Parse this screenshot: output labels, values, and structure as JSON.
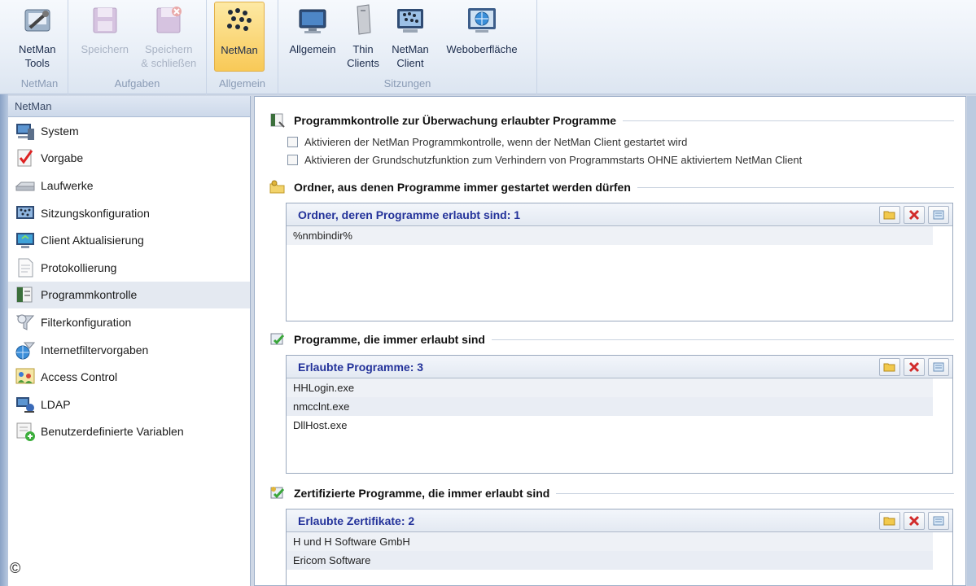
{
  "ribbon": {
    "groups": [
      {
        "label": "NetMan",
        "buttons": [
          {
            "label1": "NetMan",
            "label2": "Tools",
            "icon": "tools-icon"
          }
        ]
      },
      {
        "label": "Aufgaben",
        "buttons": [
          {
            "label1": "Speichern",
            "label2": "",
            "icon": "floppy-icon"
          },
          {
            "label1": "Speichern",
            "label2": "& schließen",
            "icon": "floppy-close-icon"
          }
        ]
      },
      {
        "label": "Allgemein",
        "buttons": [
          {
            "label1": "NetMan",
            "label2": "",
            "icon": "netman-dots-icon"
          }
        ]
      },
      {
        "label": "Sitzungen",
        "buttons": [
          {
            "label1": "Allgemein",
            "label2": "",
            "icon": "monitor-icon"
          },
          {
            "label1": "Thin",
            "label2": "Clients",
            "icon": "thin-client-icon"
          },
          {
            "label1": "NetMan",
            "label2": "Client",
            "icon": "netman-client-icon"
          },
          {
            "label1": "Weboberfläche",
            "label2": "",
            "icon": "web-icon"
          }
        ]
      }
    ]
  },
  "nav": {
    "header": "NetMan",
    "items": [
      {
        "label": "System",
        "icon": "computer-icon"
      },
      {
        "label": "Vorgabe",
        "icon": "checklist-icon"
      },
      {
        "label": "Laufwerke",
        "icon": "drive-icon"
      },
      {
        "label": "Sitzungskonfiguration",
        "icon": "session-icon"
      },
      {
        "label": "Client Aktualisierung",
        "icon": "client-update-icon"
      },
      {
        "label": "Protokollierung",
        "icon": "document-icon"
      },
      {
        "label": "Programmkontrolle",
        "icon": "program-control-icon"
      },
      {
        "label": "Filterkonfiguration",
        "icon": "filter-icon"
      },
      {
        "label": "Internetfiltervorgaben",
        "icon": "internet-filter-icon"
      },
      {
        "label": "Access Control",
        "icon": "access-control-icon"
      },
      {
        "label": "LDAP",
        "icon": "ldap-icon"
      },
      {
        "label": "Benutzerdefinierte Variablen",
        "icon": "variables-icon"
      }
    ],
    "selected_index": 6
  },
  "content": {
    "section1": {
      "title": "Programmkontrolle zur Überwachung erlaubter Programme",
      "checkboxes": [
        "Aktivieren der NetMan Programmkontrolle, wenn der NetMan Client gestartet wird",
        "Aktivieren der Grundschutzfunktion zum Verhindern von Programmstarts OHNE aktiviertem NetMan Client"
      ]
    },
    "section2": {
      "title": "Ordner, aus denen Programme immer gestartet werden dürfen",
      "list_title": "Ordner, deren Programme erlaubt sind: 1",
      "rows": [
        "%nmbindir%"
      ]
    },
    "section3": {
      "title": "Programme, die immer erlaubt sind",
      "list_title": "Erlaubte Programme: 3",
      "rows": [
        "HHLogin.exe",
        "nmcclnt.exe",
        "DllHost.exe"
      ]
    },
    "section4": {
      "title": "Zertifizierte Programme, die immer erlaubt sind",
      "list_title": "Erlaubte Zertifikate: 2",
      "rows": [
        "H und H Software GmbH",
        "Ericom Software"
      ]
    }
  },
  "copyright_symbol": "©",
  "colors": {
    "accent": "#23329a",
    "ribbon_active": "#f8c957",
    "selection": "#e4e9f1"
  }
}
